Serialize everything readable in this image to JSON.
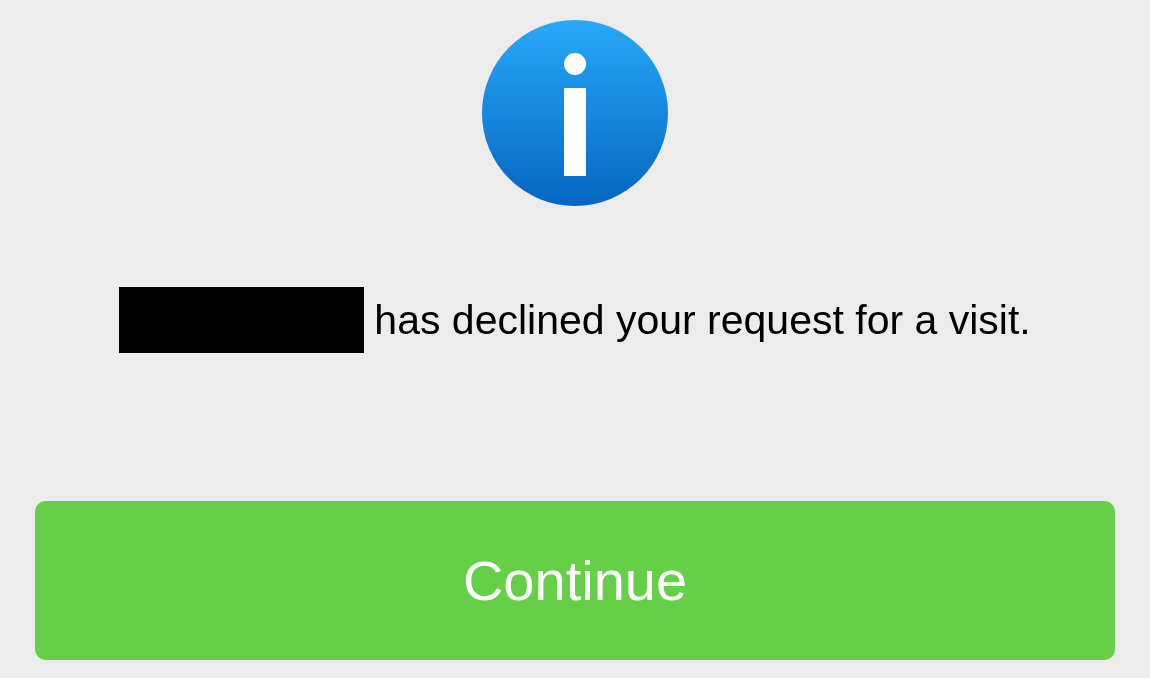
{
  "message": {
    "redacted_name": true,
    "text": "has declined your request for a visit."
  },
  "button": {
    "label": "Continue"
  }
}
